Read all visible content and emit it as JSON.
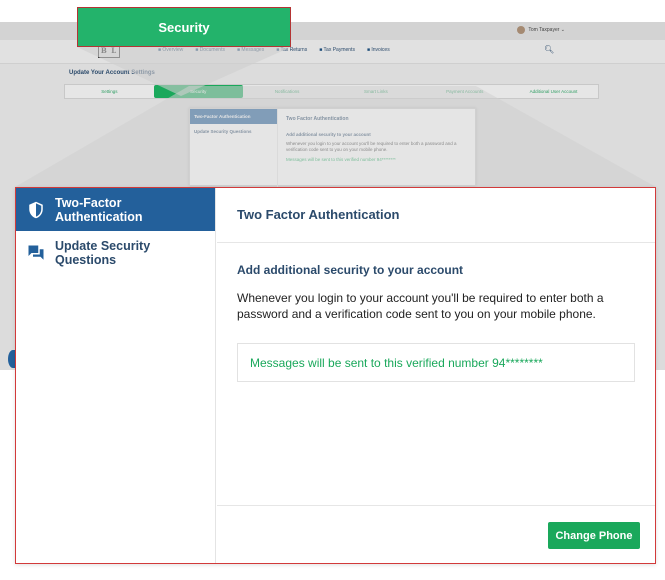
{
  "background": {
    "user_name": "Tom Taxpayer ⌄",
    "logo": "B L",
    "nav_items": [
      "Overview",
      "Documents",
      "Messages",
      "Tax Returns",
      "Tax Payments",
      "Invoices"
    ],
    "page_title": "Update Your Account Settings",
    "tabs": [
      "Settings",
      "Security",
      "Notifications",
      "Smart Links",
      "Payment Accounts",
      "Additional User Account"
    ],
    "mini_panel": {
      "side_active": "Two-Factor Authentication",
      "side_inactive": "Update Security Questions",
      "header": "Two Factor Authentication",
      "heading": "Add additional security to your account",
      "text": "Whenever you login to your account you'll be required to enter both a password and a verification code sent to you on your mobile phone.",
      "verified": "Messages will be sent to this verified number 94********"
    }
  },
  "callout": {
    "label": "Security"
  },
  "panel": {
    "sidebar": [
      {
        "label": "Two-Factor Authentication",
        "icon": "shield-icon",
        "active": true
      },
      {
        "label": "Update Security Questions",
        "icon": "chat-bubbles-icon",
        "active": false
      }
    ],
    "header_title": "Two Factor Authentication",
    "body_heading": "Add additional security to your account",
    "body_text": "Whenever you login to your account you'll be required to enter both a password and a verification code sent to you on your mobile phone.",
    "verified_message": "Messages will be sent to this verified number 94********",
    "change_phone_label": "Change Phone"
  },
  "colors": {
    "primary_blue": "#23609b",
    "accent_green": "#1aa85b",
    "highlight_border": "#d23a3a"
  }
}
